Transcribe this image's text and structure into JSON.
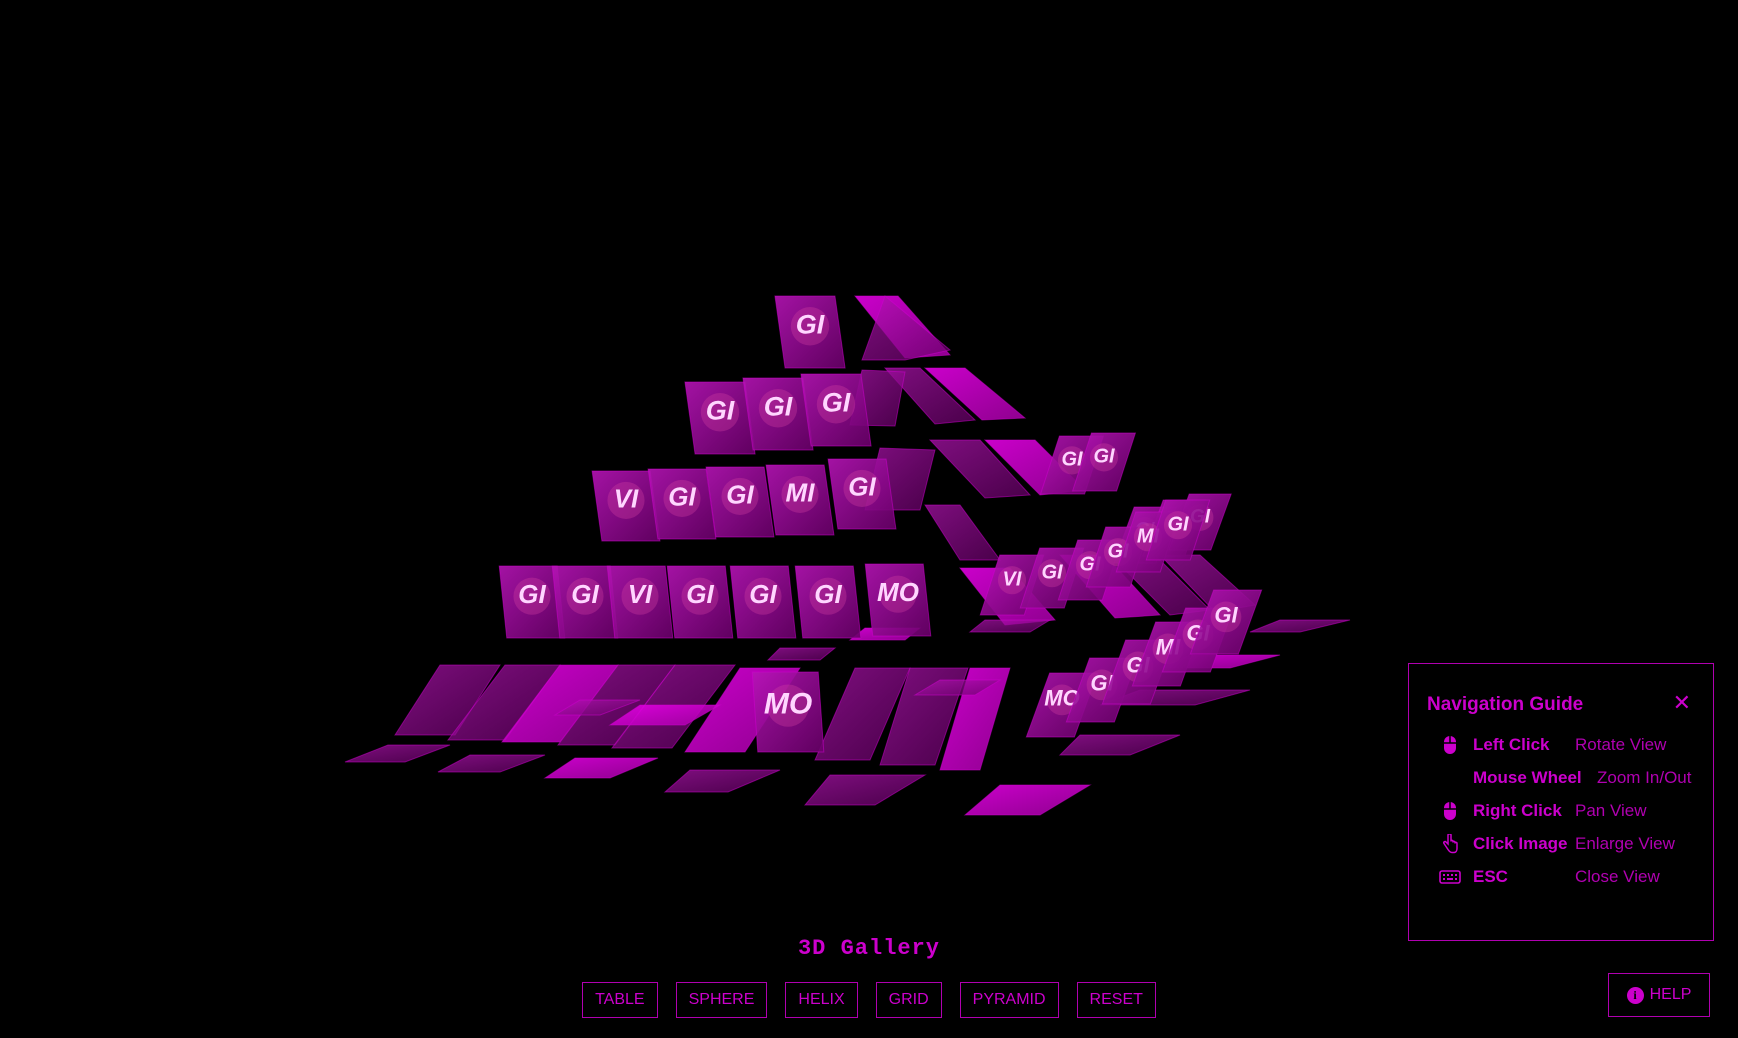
{
  "gallery": {
    "title": "3D Gallery",
    "view_mode": "PYRAMID",
    "buttons": [
      "TABLE",
      "SPHERE",
      "HELIX",
      "GRID",
      "PYRAMID",
      "RESET"
    ]
  },
  "nav_guide": {
    "title": "Navigation Guide",
    "close_icon": "close-icon",
    "rows": [
      {
        "key": "Left Click",
        "action": "Rotate View",
        "icon": "mouse-icon"
      },
      {
        "key": "Mouse Wheel",
        "action": "Zoom In/Out",
        "icon": ""
      },
      {
        "key": "Right Click",
        "action": "Pan View",
        "icon": "mouse-icon"
      },
      {
        "key": "Click Image",
        "action": "Enlarge View",
        "icon": "pointer-hand-icon"
      },
      {
        "key": "ESC",
        "action": "Close View",
        "icon": "keyboard-icon"
      }
    ]
  },
  "help": {
    "label": "HELP",
    "icon": "info-icon"
  },
  "tiles": [
    "GI",
    "GI",
    "GI",
    "GI",
    "VI",
    "GI",
    "GI",
    "MI",
    "GI",
    "GI",
    "GI",
    "VI",
    "GI",
    "GI",
    "GI",
    "MO",
    "MO",
    "GI",
    "GI",
    "GI",
    "GI",
    "MI",
    "GI",
    "VI",
    "GI",
    "GI",
    "GI",
    "MI",
    "GI",
    "MO",
    "GI",
    "GI",
    "MI",
    "GI",
    "GI"
  ],
  "colors": {
    "accent": "#cc00cc",
    "tile": "#9a009a",
    "background": "#000000"
  }
}
